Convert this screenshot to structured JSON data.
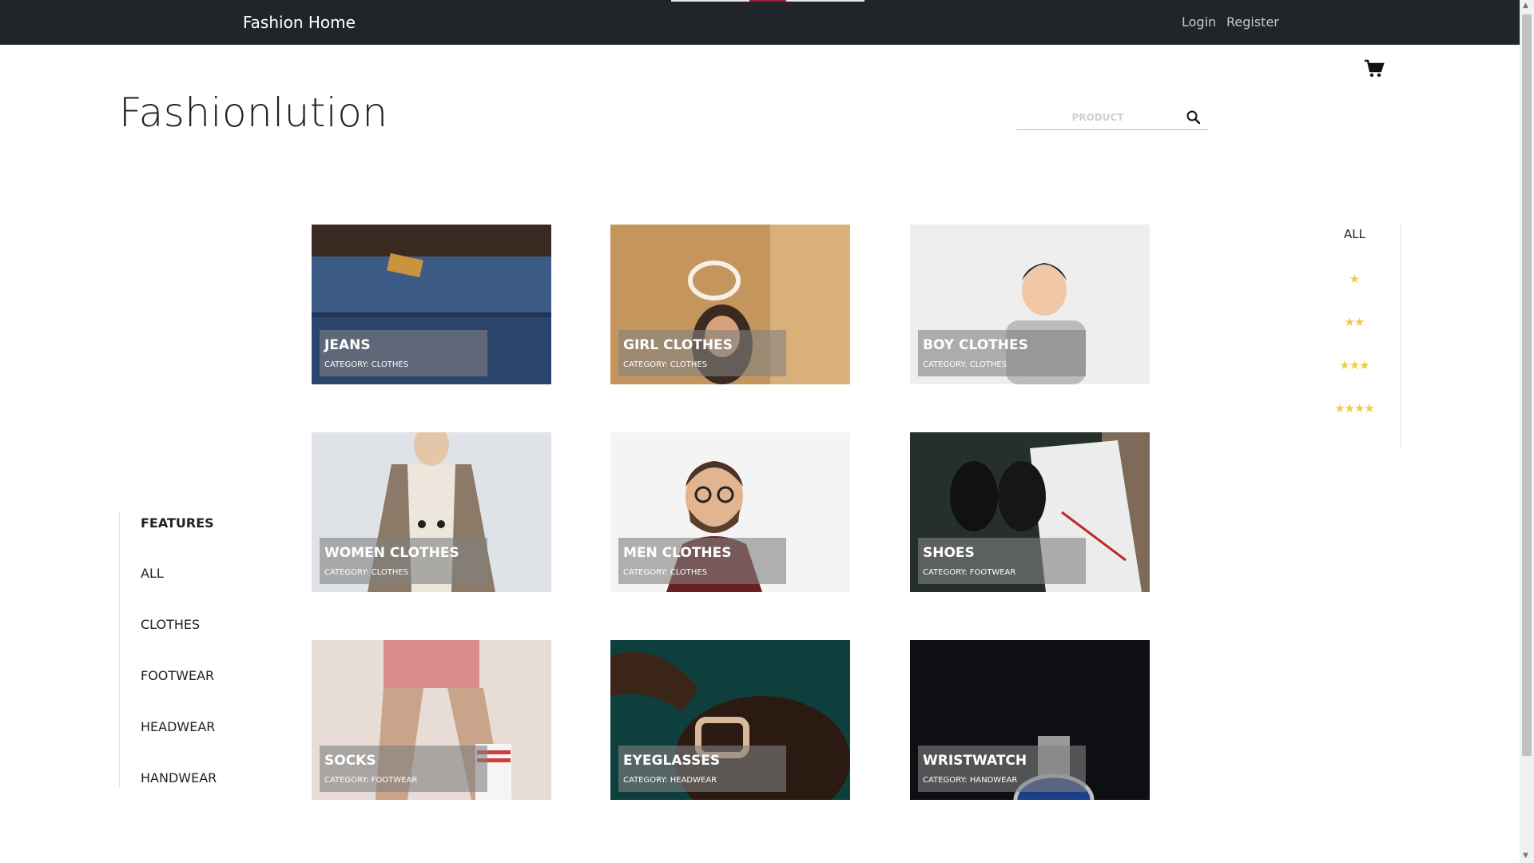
{
  "navbar": {
    "brand": "Fashion Home",
    "login": "Login",
    "register": "Register"
  },
  "header": {
    "site_title": "Fashionlution",
    "search_placeholder": "PRODUCT",
    "cart_icon": "shopping-cart-icon",
    "search_icon": "search-icon"
  },
  "categories": {
    "title": "FEATURES",
    "items": [
      "ALL",
      "CLOTHES",
      "FOOTWEAR",
      "HEADWEAR",
      "HANDWEAR"
    ]
  },
  "products": [
    {
      "name": "JEANS",
      "category": "CATEGORY: CLOTHES",
      "bg": "#2f4a72"
    },
    {
      "name": "GIRL CLOTHES",
      "category": "CATEGORY: CLOTHES",
      "bg": "#c4965e"
    },
    {
      "name": "BOY CLOTHES",
      "category": "CATEGORY: CLOTHES",
      "bg": "#eeeeee"
    },
    {
      "name": "WOMEN CLOTHES",
      "category": "CATEGORY: CLOTHES",
      "bg": "#dfe3e7"
    },
    {
      "name": "MEN CLOTHES",
      "category": "CATEGORY: CLOTHES",
      "bg": "#f4f4f4"
    },
    {
      "name": "SHOES",
      "category": "CATEGORY: FOOTWEAR",
      "bg": "#26302b"
    },
    {
      "name": "SOCKS",
      "category": "CATEGORY: FOOTWEAR",
      "bg": "#e7ddd6"
    },
    {
      "name": "EYEGLASSES",
      "category": "CATEGORY: HEADWEAR",
      "bg": "#0f3f3d"
    },
    {
      "name": "WRISTWATCH",
      "category": "CATEGORY: HANDWEAR",
      "bg": "#0d0f13"
    }
  ],
  "ratings": {
    "all": "ALL",
    "levels": [
      "★",
      "★★",
      "★★★",
      "★★★★"
    ]
  },
  "colors": {
    "navbar": "#212529",
    "accent": "#a31c3c",
    "star": "#f0c94a",
    "overlay": "rgba(128,128,128,0.6)"
  }
}
